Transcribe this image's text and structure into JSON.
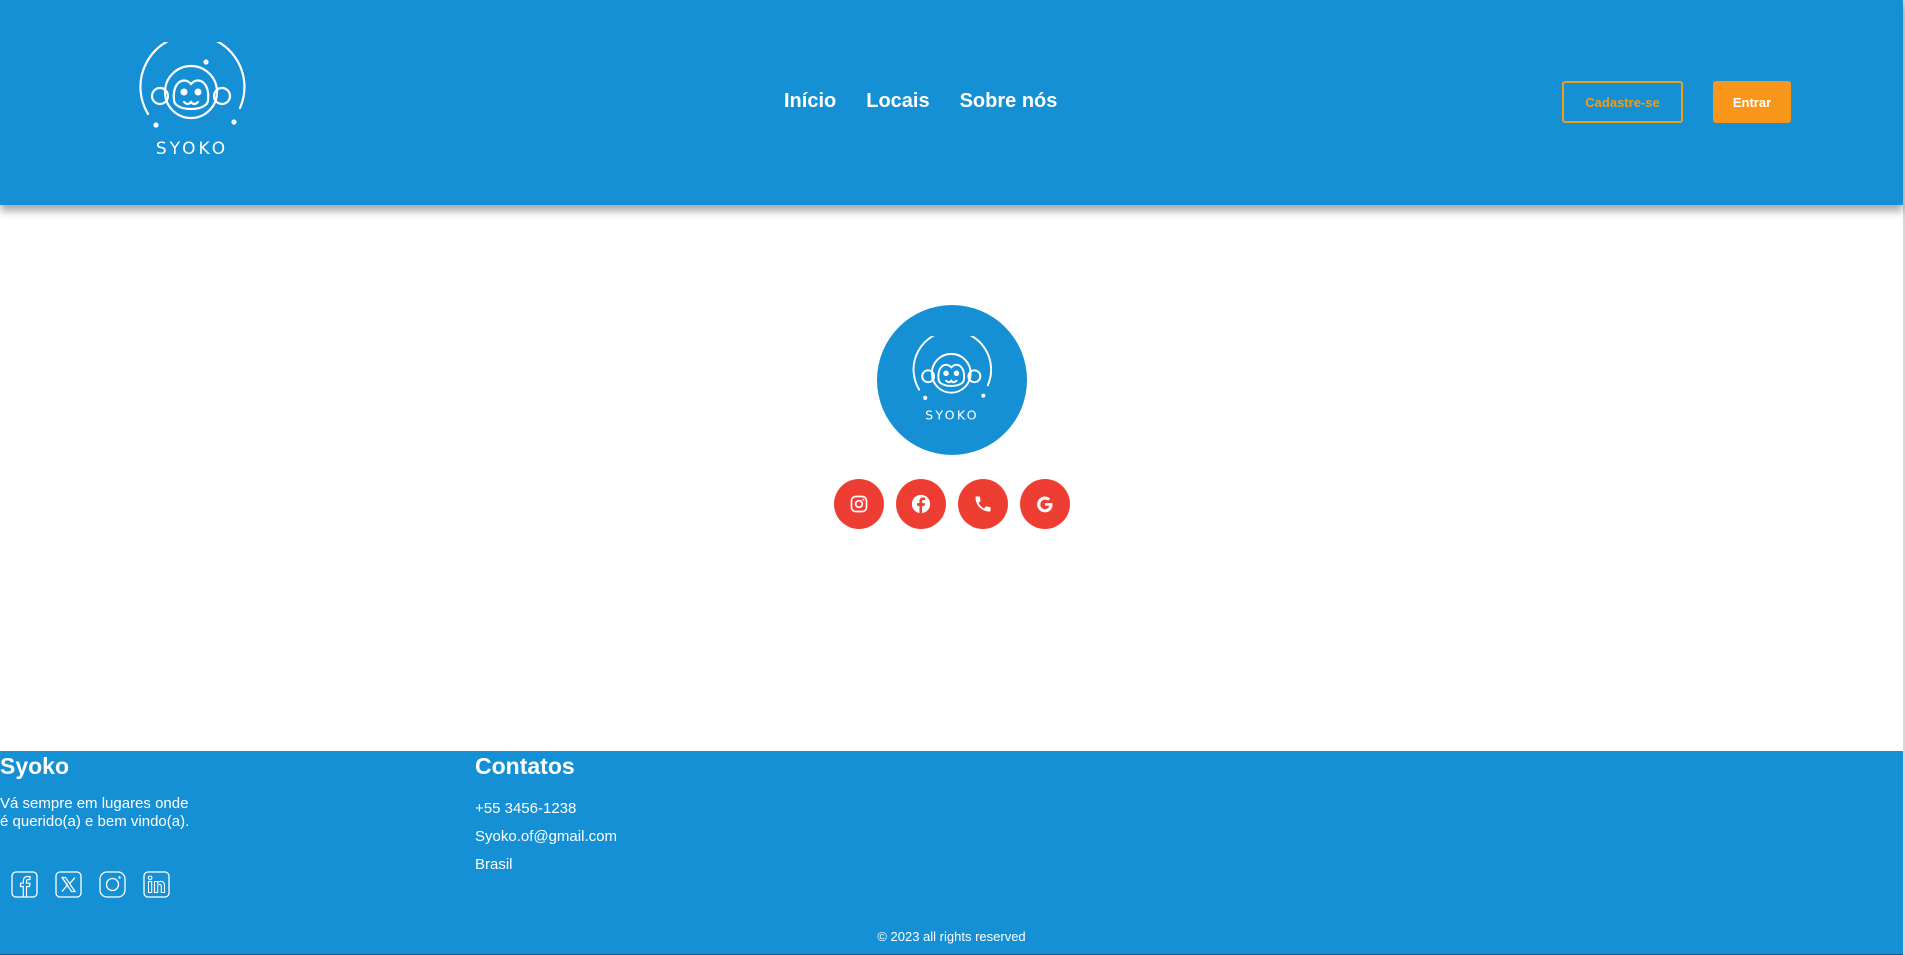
{
  "header": {
    "logo_text": "SYOKO",
    "nav": [
      {
        "label": "Início"
      },
      {
        "label": "Locais"
      },
      {
        "label": "Sobre nós"
      }
    ],
    "signup_label": "Cadastre-se",
    "login_label": "Entrar"
  },
  "main": {
    "logo_text": "SYOKO",
    "social_icons": [
      "instagram-icon",
      "facebook-icon",
      "phone-icon",
      "google-icon"
    ]
  },
  "footer": {
    "brand": "Syoko",
    "tagline_line1": "Vá sempre em lugares onde",
    "tagline_line2": "é querido(a) e bem vindo(a).",
    "social_icons": [
      "facebook-icon",
      "x-icon",
      "instagram-icon",
      "linkedin-icon"
    ],
    "contacts_title": "Contatos",
    "contacts": [
      "+55 3456-1238",
      "Syoko.of@gmail.com",
      "Brasil"
    ],
    "copyright": "© 2023 all rights reserved"
  },
  "colors": {
    "primary_blue": "#1590d4",
    "accent_orange": "#f7961a",
    "social_red": "#ee3e34",
    "white": "#ffffff"
  }
}
